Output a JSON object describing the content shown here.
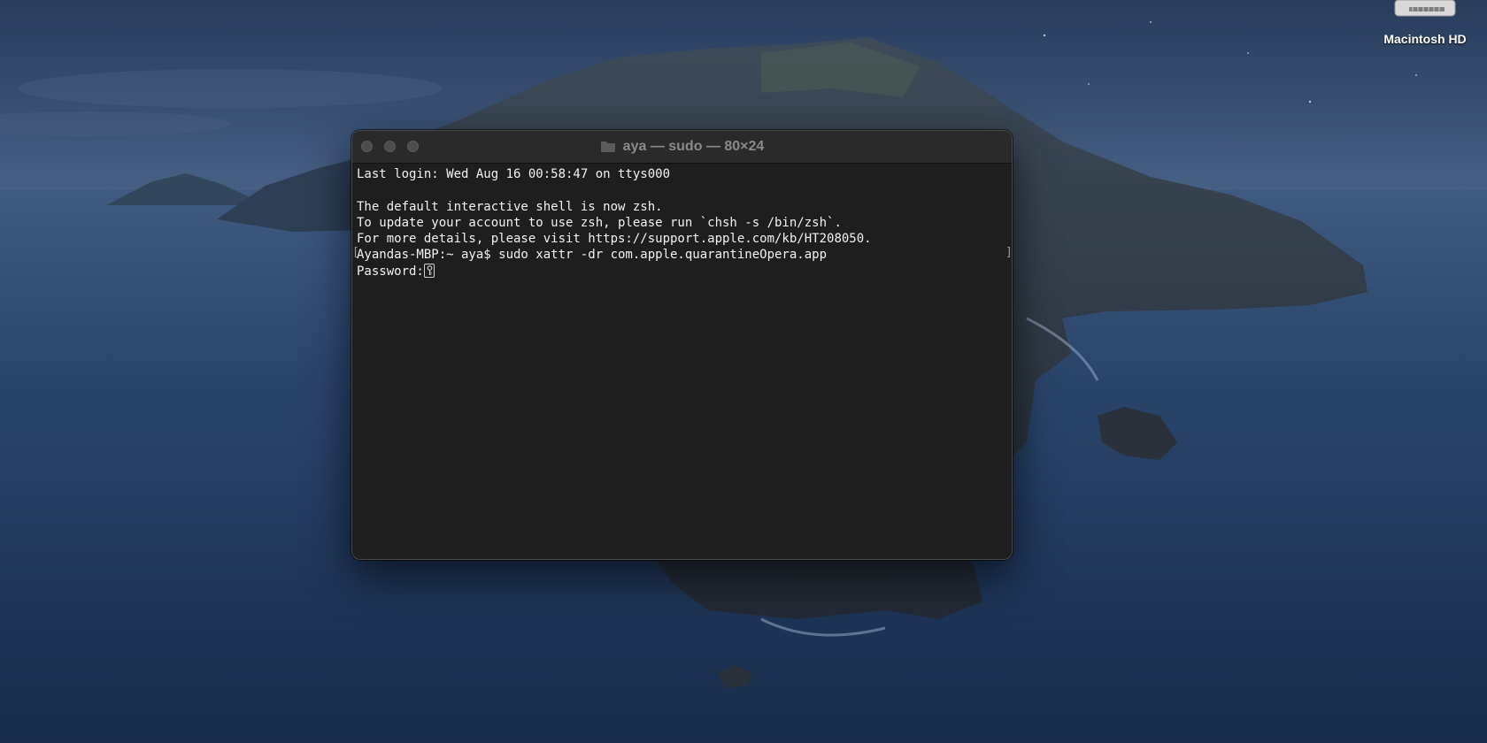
{
  "desktop": {
    "drive_label": "Macintosh HD"
  },
  "terminal": {
    "title": "aya — sudo — 80×24",
    "lines": [
      "Last login: Wed Aug 16 00:58:47 on ttys000",
      "",
      "The default interactive shell is now zsh.",
      "To update your account to use zsh, please run `chsh -s /bin/zsh`.",
      "For more details, please visit https://support.apple.com/kb/HT208050.",
      "Ayandas-MBP:~ aya$ sudo xattr -dr com.apple.quarantineOpera.app"
    ],
    "password_prompt": "Password:"
  },
  "colors": {
    "terminal_bg": "#1e1e1e",
    "titlebar_bg": "#2a2a2a",
    "text": "#f2f2f2"
  },
  "icons": {
    "window_close": "traffic-light-close",
    "window_minimize": "traffic-light-minimize",
    "window_maximize": "traffic-light-maximize",
    "title_folder": "folder-icon",
    "password_cursor": "key-icon",
    "drive": "hard-drive-icon"
  }
}
